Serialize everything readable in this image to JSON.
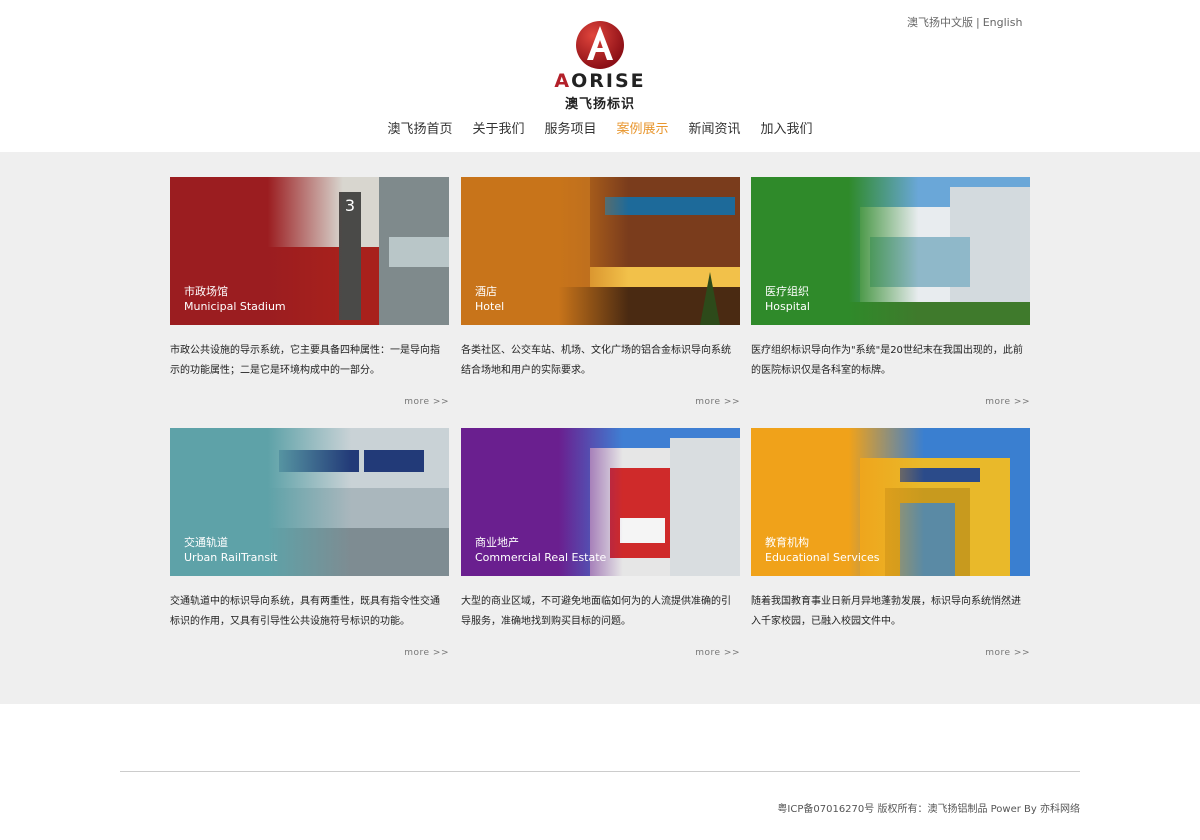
{
  "header": {
    "lang_cn": "澳飞扬中文版",
    "lang_sep": "|",
    "lang_en": "English",
    "logo": {
      "mark_icon": "aorise-logo-icon",
      "word_a": "A",
      "word_o": "O",
      "word_rest": "RISE",
      "text_cn": "澳飞扬标识"
    },
    "nav": [
      {
        "label": "澳飞扬首页",
        "active": false
      },
      {
        "label": "关于我们",
        "active": false
      },
      {
        "label": "服务项目",
        "active": false
      },
      {
        "label": "案例展示",
        "active": true
      },
      {
        "label": "新闻资讯",
        "active": false
      },
      {
        "label": "加入我们",
        "active": false
      }
    ]
  },
  "cards": [
    {
      "title_cn": "市政场馆",
      "title_en": "Municipal Stadium",
      "theme_color": "#9b1d20",
      "desc": "市政公共设施的导示系统，它主要具备四种属性：一是导向指示的功能属性；二是它是环境构成中的一部分。",
      "more": "more >>"
    },
    {
      "title_cn": "酒店",
      "title_en": "Hotel",
      "theme_color": "#c8741a",
      "desc": "各类社区、公交车站、机场、文化广场的铝合金标识导向系统结合场地和用户的实际要求。",
      "more": "more >>"
    },
    {
      "title_cn": "医疗组织",
      "title_en": "Hospital",
      "theme_color": "#2f8a2a",
      "desc": "医疗组织标识导向作为\"系统\"是20世纪末在我国出现的，此前的医院标识仅是各科室的标牌。",
      "more": "more >>"
    },
    {
      "title_cn": "交通轨道",
      "title_en": "Urban RailTransit",
      "theme_color": "#5ea2a8",
      "desc": "交通轨道中的标识导向系统，具有两重性，既具有指令性交通标识的作用，又具有引导性公共设施符号标识的功能。",
      "more": "more >>"
    },
    {
      "title_cn": "商业地产",
      "title_en": "Commercial Real Estate",
      "theme_color": "#6a1f8f",
      "desc": "大型的商业区域，不可避免地面临如何为的人流提供准确的引导服务，准确地找到购买目标的问题。",
      "more": "more >>"
    },
    {
      "title_cn": "教育机构",
      "title_en": "Educational Services",
      "theme_color": "#f0a21a",
      "desc": "随着我国教育事业日新月异地蓬勃发展，标识导向系统悄然进入千家校园，已融入校园文件中。",
      "more": "more >>"
    }
  ],
  "footer": {
    "copyright": "粤ICP备07016270号 版权所有：澳飞扬铝制品 Power By 亦科网络"
  }
}
